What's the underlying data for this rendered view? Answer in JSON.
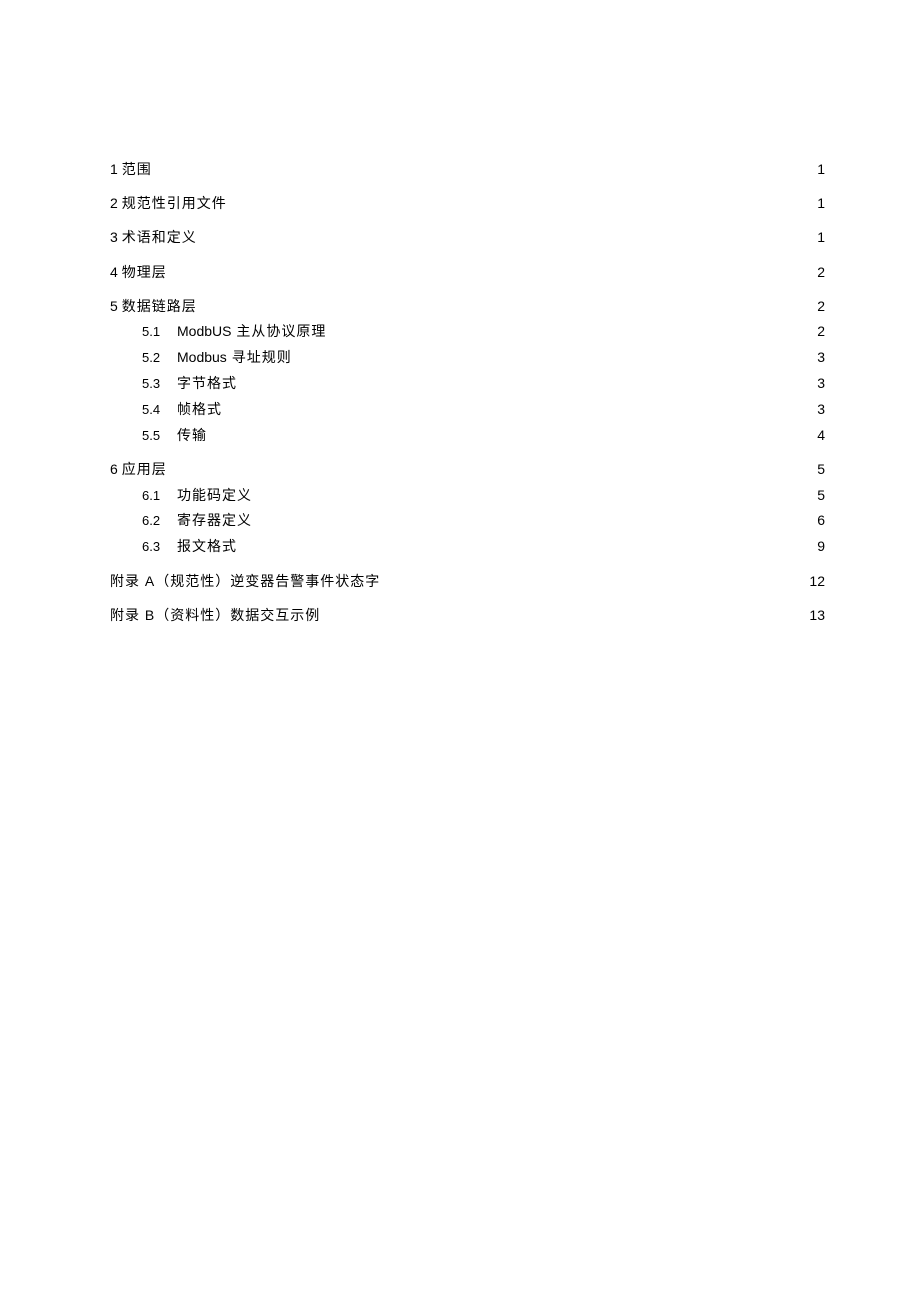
{
  "toc": [
    {
      "num": "1",
      "title": "范围",
      "page": "1",
      "level": 1
    },
    {
      "num": "2",
      "title": "规范性引用文件",
      "page": "1",
      "level": 1
    },
    {
      "num": "3",
      "title": "术语和定义",
      "page": "1",
      "level": 1
    },
    {
      "num": "4",
      "title": "物理层",
      "page": "2",
      "level": 1
    },
    {
      "num": "5",
      "title": "数据链路层",
      "page": "2",
      "level": 1
    },
    {
      "num": "5.1",
      "title_latin": "ModbUS",
      "title": " 主从协议原理",
      "page": "2",
      "level": 2
    },
    {
      "num": "5.2",
      "title_latin": "Modbus",
      "title": " 寻址规则",
      "page": "3",
      "level": 2
    },
    {
      "num": "5.3",
      "title": "字节格式",
      "page": "3",
      "level": 2
    },
    {
      "num": "5.4",
      "title": "帧格式",
      "page": "3",
      "level": 2
    },
    {
      "num": "5.5",
      "title": "传输",
      "page": "4",
      "level": 2
    },
    {
      "num": "6",
      "title": "应用层",
      "page": "5",
      "level": 1
    },
    {
      "num": "6.1",
      "title": "功能码定义",
      "page": "5",
      "level": 2
    },
    {
      "num": "6.2",
      "title": "寄存器定义",
      "page": "6",
      "level": 2
    },
    {
      "num": "6.3",
      "title": "报文格式",
      "page": "9",
      "level": 2
    },
    {
      "num": "",
      "title": "附录 A（规范性）逆变器告警事件状态字",
      "page": "12",
      "level": 1
    },
    {
      "num": "",
      "title": "附录 B（资料性）数据交互示例",
      "page": "13",
      "level": 1
    }
  ]
}
